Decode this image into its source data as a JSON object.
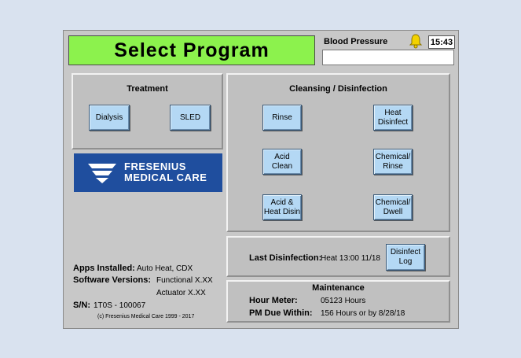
{
  "header": {
    "title": "Select Program",
    "bp_label": "Blood Pressure",
    "bp_value": "",
    "time": "15:43"
  },
  "treatment": {
    "title": "Treatment",
    "dialysis": "Dialysis",
    "sled": "SLED"
  },
  "logo": {
    "line1": "FRESENIUS",
    "line2": "MEDICAL CARE"
  },
  "cleansing": {
    "title": "Cleansing / Disinfection",
    "rinse": "Rinse",
    "heat_disinfect": "Heat\nDisinfect",
    "acid_clean": "Acid\nClean",
    "chemical_rinse": "Chemical/\nRinse",
    "acid_heat": "Acid &\nHeat Disin",
    "chemical_dwell": "Chemical/\nDwell"
  },
  "info": {
    "apps_label": "Apps Installed:",
    "apps_value": "Auto Heat, CDX",
    "software_label": "Software Versions:",
    "software_value1": "Functional X.XX",
    "software_value2": "Actuator X.XX",
    "sn_label": "S/N:",
    "sn_value": "1T0S - 100067",
    "copyright": "(c) Fresenius Medical Care 1999 - 2017"
  },
  "disinfection": {
    "label": "Last Disinfection:",
    "value": "Heat 13:00 11/18",
    "log_button": "Disinfect\nLog"
  },
  "maintenance": {
    "title": "Maintenance",
    "hour_label": "Hour Meter:",
    "hour_value": "05123 Hours",
    "pm_label": "PM Due Within:",
    "pm_value": "156 Hours or by 8/28/18"
  },
  "colors": {
    "title_bg": "#8cf24d",
    "button_bg": "#b4d8f4",
    "logo_bg": "#1f4e9e",
    "panel_bg": "#c0c0c0"
  }
}
